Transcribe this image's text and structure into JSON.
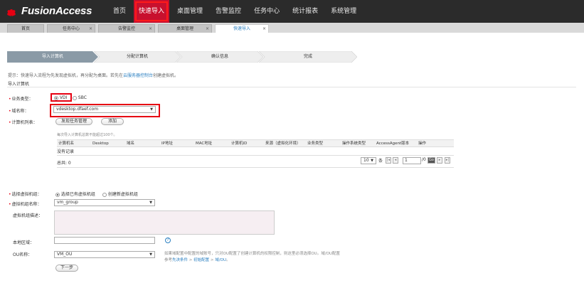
{
  "app": {
    "logo_text": "FusionAccess"
  },
  "nav": {
    "items": [
      "首页",
      "快速导入",
      "桌面管理",
      "告警监控",
      "任务中心",
      "统计报表",
      "系统管理"
    ],
    "active_index": 1
  },
  "tabs": [
    {
      "label": "首页",
      "closable": false
    },
    {
      "label": "任务中心",
      "closable": true
    },
    {
      "label": "告警监控",
      "closable": true
    },
    {
      "label": "桌面管理",
      "closable": true
    },
    {
      "label": "快速导入",
      "closable": true,
      "active": true
    }
  ],
  "steps": [
    "导入计算机",
    "分配计算机",
    "确认信息",
    "完成"
  ],
  "hint": {
    "prefix": "提示：快速导入流程为先发现虚拟机，再分配为桌面。若先在",
    "link": "云服务器控制台",
    "suffix": "创建虚拟机。"
  },
  "section_title": "导入计算机",
  "business_type": {
    "label": "业务类型：",
    "options": [
      "VDI",
      "SBC"
    ],
    "selected": "VDI"
  },
  "domain": {
    "label": "域名称：",
    "value": "vdesktop.dfaef.com"
  },
  "computer_list": {
    "label": "计算机列表：",
    "buttons": [
      "发现任务管理",
      "添加"
    ],
    "limit_hint": "每次导入计算机总数不能超过100个。",
    "columns": [
      "计算机名",
      "Desktop",
      "域名",
      "IP地址",
      "MAC地址",
      "计算机ID",
      "来源（虚拟化环境）",
      "业务类型",
      "操作系统类型",
      "AccessAgent版本",
      "操作"
    ],
    "empty_text": "没有记录",
    "total_text": "总共: 0",
    "page_size": "10",
    "page_label_prefix": "条",
    "page_input": "1",
    "page_total": "/0",
    "go_label": "Go"
  },
  "vm_group": {
    "label": "选择虚拟机组：",
    "options": [
      "选择已有虚拟机组",
      "创建新虚拟机组"
    ],
    "selected": "选择已有虚拟机组",
    "name_label": "虚拟机组名称：",
    "name_value": "vm_group",
    "desc_label": "虚拟机组描述："
  },
  "local_area": {
    "label": "本地区域：",
    "value": ""
  },
  "ou": {
    "label": "OU名称：",
    "value": "VM_OU",
    "hint_line1": "如果域配置中配置的域账号，只对OU配置了创建计算机的权限控制，则这里必须选择OU。域/OU配置",
    "hint_line2_prefix": "参考",
    "hint_link1": "先决条件",
    "hint_sep1": " > ",
    "hint_link2": "初始配置",
    "hint_sep2": " > ",
    "hint_link3": "域/OU",
    "hint_suffix": "。"
  },
  "next_button": "下一步",
  "colors": {
    "accent_red": "#e60012",
    "link_blue": "#2a7fc1",
    "topbar": "#2b2b2b"
  }
}
